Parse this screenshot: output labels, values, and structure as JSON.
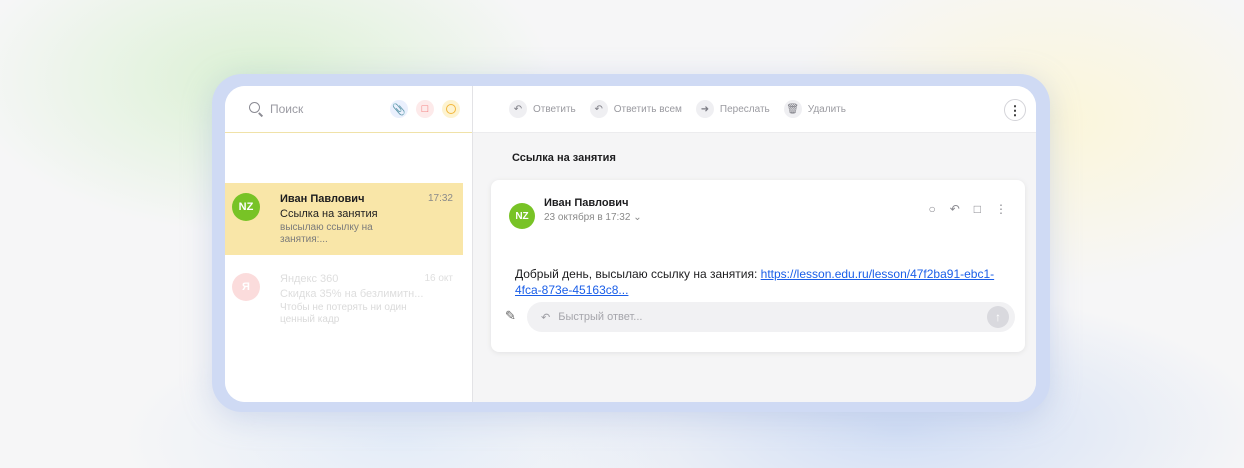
{
  "search": {
    "placeholder": "Поиск"
  },
  "filters": [
    {
      "icon": "paperclip-icon",
      "color": "#5f8cf2"
    },
    {
      "icon": "bookmark-icon",
      "color": "#f26b6b"
    },
    {
      "icon": "unread-dot-icon",
      "color": "#f2b63b"
    }
  ],
  "messages": [
    {
      "avatar": "NZ",
      "sender": "Иван Павлович",
      "time": "17:32",
      "subject": "Ссылка на занятия",
      "preview": "высылаю ссылку на занятия:..."
    },
    {
      "avatar": "Я",
      "sender": "Яндекс 360",
      "time": "16 окт",
      "subject": "Скидка 35% на безлимитн...",
      "preview": "Чтобы не потерять ни один ценный кадр"
    }
  ],
  "toolbar": {
    "reply": "Ответить",
    "reply_all": "Ответить всем",
    "forward": "Переслать",
    "delete": "Удалить"
  },
  "thread": {
    "title": "Ссылка на занятия",
    "sender": "Иван Павлович",
    "avatar": "NZ",
    "date": "23 октября в 17:32",
    "body_text": "Добрый день, высылаю ссылку на занятия: ",
    "link": "https://lesson.edu.ru/lesson/47f2ba91-ebc1-4fca-873e-45163c8...",
    "quick_reply_placeholder": "Быстрый ответ..."
  },
  "colors": {
    "accent_green": "#78c326",
    "selected_row": "#f9e6a8",
    "link": "#1a5ee8",
    "frame": "#cfdaf4"
  }
}
